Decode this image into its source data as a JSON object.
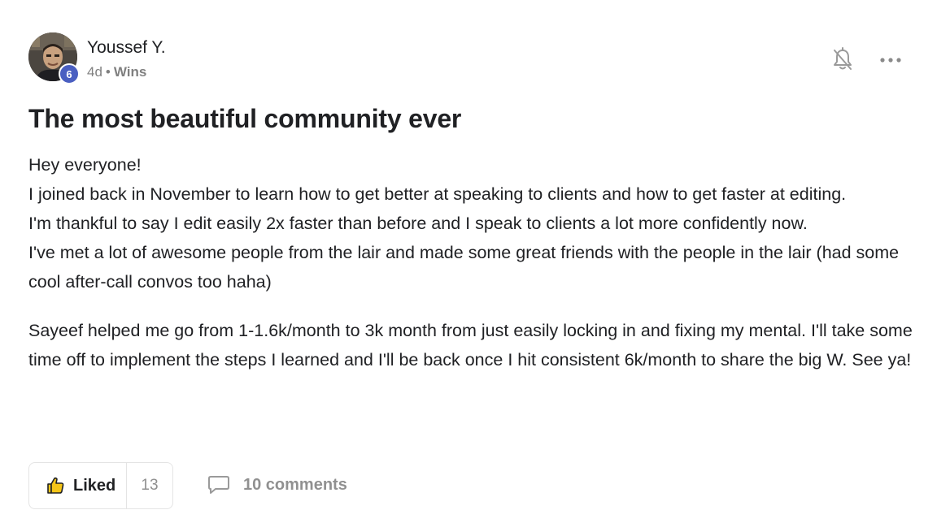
{
  "author": {
    "name": "Youssef Y.",
    "level": "6",
    "time": "4d",
    "separator": "•",
    "category": "Wins"
  },
  "post": {
    "title": "The most beautiful community ever",
    "paragraphs": [
      "Hey everyone!",
      "I joined back in November to learn how to get better at speaking to clients and how to get faster at editing.",
      "I'm thankful to say I edit easily 2x faster than before and I speak to clients a lot more confidently now.",
      "I've met a lot of awesome people from the lair and made some great friends with the people in the lair (had some cool after-call convos too haha)",
      "Sayeef helped me go from 1-1.6k/month to 3k month from just easily locking in and fixing my mental. I'll take some time off to implement the steps I learned and I'll be back once I hit consistent 6k/month to share the big W. See ya!"
    ]
  },
  "actions": {
    "like_label": "Liked",
    "like_count": "13",
    "comments_label": "10 comments"
  },
  "icons": {
    "bell": "bell-off-icon",
    "more": "more-horizontal-icon",
    "thumb": "thumbs-up-icon",
    "comment": "comment-bubble-icon"
  },
  "colors": {
    "badge": "#4a5fc1",
    "thumb": "#f5c518",
    "muted": "#909090",
    "text": "#202124"
  }
}
